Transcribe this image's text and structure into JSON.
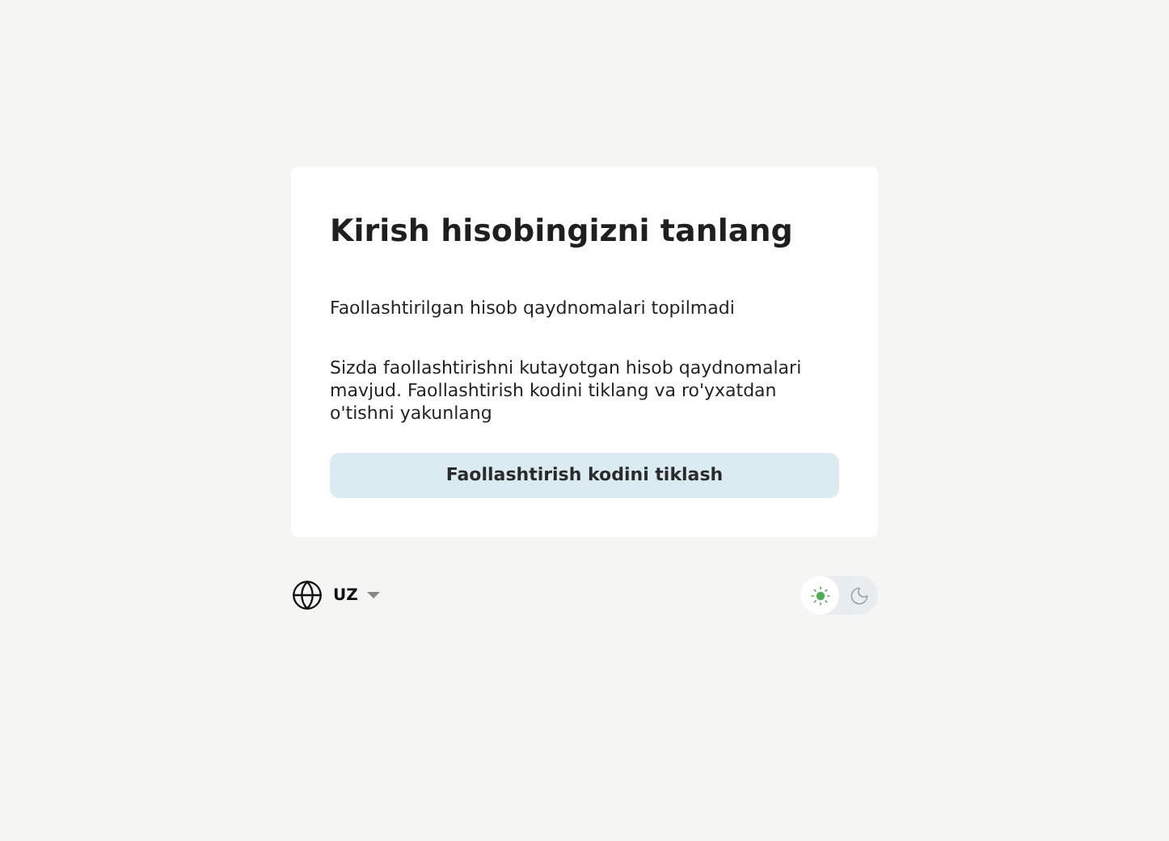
{
  "card": {
    "title": "Kirish hisobingizni tanlang",
    "message": "Faollashtirilgan hisob qaydnomalari topilmadi",
    "description": "Sizda faollashtirishni kutayotgan hisob qaydnomalari mavjud. Faollashtirish kodini tiklang va ro'yxatdan o'tishni yakunlang",
    "button": "Faollashtirish kodini tiklash"
  },
  "language": {
    "code": "UZ"
  },
  "theme_toggle": [
    {
      "kind": "light",
      "selected": true
    },
    {
      "kind": "dark",
      "selected": false
    }
  ]
}
